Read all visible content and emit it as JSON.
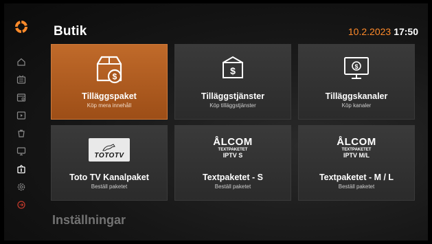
{
  "header": {
    "title": "Butik",
    "date": "10.2.2023",
    "time": "17:50"
  },
  "sidebar": {
    "items": [
      {
        "icon": "home-icon"
      },
      {
        "icon": "tv-guide-icon"
      },
      {
        "icon": "recordings-icon"
      },
      {
        "icon": "vod-icon"
      },
      {
        "icon": "trash-icon"
      },
      {
        "icon": "monitor-icon"
      },
      {
        "icon": "shop-icon",
        "active": true
      },
      {
        "icon": "settings-icon"
      },
      {
        "icon": "power-icon"
      }
    ]
  },
  "tiles": [
    {
      "label": "Tilläggspaket",
      "sub": "Köp mera innehåll",
      "icon": "package-dollar-icon",
      "selected": true
    },
    {
      "label": "Tilläggstjänster",
      "sub": "Köp tilläggstjänster",
      "icon": "box-dollar-icon"
    },
    {
      "label": "Tilläggskanaler",
      "sub": "Köp kanaler",
      "icon": "tv-dollar-icon"
    },
    {
      "label": "Toto TV Kanalpaket",
      "sub": "Beställ paketet",
      "logo": {
        "text": "TOTOTV"
      }
    },
    {
      "label": "Textpaketet - S",
      "sub": "Beställ paketet",
      "logo": {
        "brand": "ÅLCOM",
        "small": "TEXTPAKETET",
        "line": "IPTV S"
      }
    },
    {
      "label": "Textpaketet - M / L",
      "sub": "Beställ paketet",
      "logo": {
        "brand": "ÅLCOM",
        "small": "TEXTPAKETET",
        "line": "IPTV M/L"
      }
    }
  ],
  "section": {
    "title": "Inställningar"
  },
  "colors": {
    "accent": "#ff8a2a",
    "selected_tile": "#b05e22"
  }
}
